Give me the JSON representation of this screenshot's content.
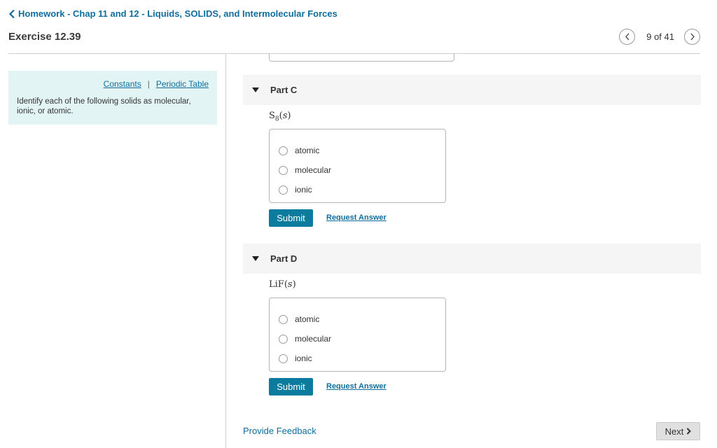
{
  "header": {
    "back_link": "Homework - Chap 11 and 12 - Liquids, SOLIDS, and Intermolecular Forces",
    "exercise_title": "Exercise 12.39",
    "pager": "9 of 41"
  },
  "info": {
    "constants_link": "Constants",
    "separator": "|",
    "periodic_table_link": "Periodic Table",
    "instructions": "Identify each of the following solids as molecular, ionic, or atomic."
  },
  "parts": [
    {
      "label": "Part C",
      "formula": {
        "base": "S",
        "subscript": "8",
        "state_open": "(",
        "state": "s",
        "state_close": ")"
      },
      "options": [
        "atomic",
        "molecular",
        "ionic"
      ],
      "submit_label": "Submit",
      "request_label": "Request Answer"
    },
    {
      "label": "Part D",
      "formula": {
        "base": "LiF",
        "subscript": "",
        "state_open": "(",
        "state": "s",
        "state_close": ")"
      },
      "options": [
        "atomic",
        "molecular",
        "ionic"
      ],
      "submit_label": "Submit",
      "request_label": "Request Answer"
    }
  ],
  "footer": {
    "feedback_link": "Provide Feedback",
    "next_label": "Next"
  },
  "colors": {
    "link": "#0f6e9e",
    "submit_bg": "#0c7c9e",
    "info_bg": "#e3f4f4",
    "part_header_bg": "#f5f5f5"
  },
  "icons": {
    "back": "chevron-left-icon",
    "prev_page": "chevron-left-icon",
    "next_page": "chevron-right-icon",
    "collapse": "caret-down-icon",
    "next": "chevron-right-icon"
  }
}
